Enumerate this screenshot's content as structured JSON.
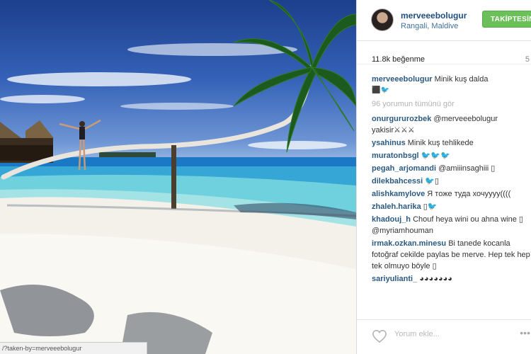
{
  "post": {
    "username": "merveeebolugur",
    "location": "Rangali, Maldive",
    "follow_label": "TAKİPTESİN",
    "likes": "11.8k beğenme",
    "likes_right": "5",
    "caption": {
      "author": "merveeebolugur",
      "text": "Minik kuş dalda",
      "emoji_line": "⬛🐦"
    },
    "view_all": "96 yorumun tümünü gör",
    "comments": [
      {
        "author": "onurgururozbek",
        "text": "@merveeebolugur yakisir⚔⚔⚔"
      },
      {
        "author": "ysahinus",
        "text": "Minik kuş tehlikede"
      },
      {
        "author": "muratonbsgl",
        "text": "🐦🐦🐦"
      },
      {
        "author": "pegah_arjomandi",
        "text": "@amiiinsaghiii ▯"
      },
      {
        "author": "dilekbahcessi",
        "text": "🐦▯"
      },
      {
        "author": "alishkamylove",
        "text": "Я тоже туда хочуууу(((("
      },
      {
        "author": "zhaleh.harika",
        "text": "▯🐦"
      },
      {
        "author": "khadouj_h",
        "text": "Chouf heya wini ou ahna wine ▯ @myriamhouman"
      },
      {
        "author": "irmak.ozkan.minesu",
        "text": "Bi tanede kocanla fotoğraf cekilde paylas be merve. Hep tek hep tek olmuyo böyle ▯"
      },
      {
        "author": "sariyulianti_",
        "text": "◕◕◕◕◕◕◕"
      }
    ],
    "comment_placeholder": "Yorum ekle...",
    "more": "•••"
  },
  "browser": {
    "status_url": "/?taken-by=merveeebolugur"
  },
  "colors": {
    "follow_green": "#6cc05a",
    "username_blue": "#2b5a83",
    "link_blue": "#3f729b"
  }
}
